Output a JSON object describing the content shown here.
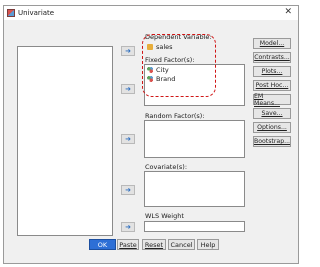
{
  "window": {
    "title": "Univariate",
    "close_glyph": "✕"
  },
  "dependent": {
    "label": "Dependent Variable:",
    "value": "sales"
  },
  "fixed": {
    "label": "Fixed Factor(s):",
    "items": [
      "City",
      "Brand"
    ]
  },
  "random": {
    "label": "Random Factor(s):"
  },
  "covariates": {
    "label": "Covariate(s):"
  },
  "wls": {
    "label": "WLS Weight"
  },
  "side_buttons": [
    "Model...",
    "Contrasts...",
    "Plots...",
    "Post Hoc...",
    "EM Means...",
    "Save...",
    "Options...",
    "Bootstrap..."
  ],
  "bottom_buttons": {
    "ok": "OK",
    "paste": "Paste",
    "reset": "Reset",
    "cancel": "Cancel",
    "help": "Help"
  },
  "icons": {
    "arrow": "➜"
  },
  "colors": {
    "ok_bg": "#2d6fd6",
    "highlight": "#d01616"
  }
}
